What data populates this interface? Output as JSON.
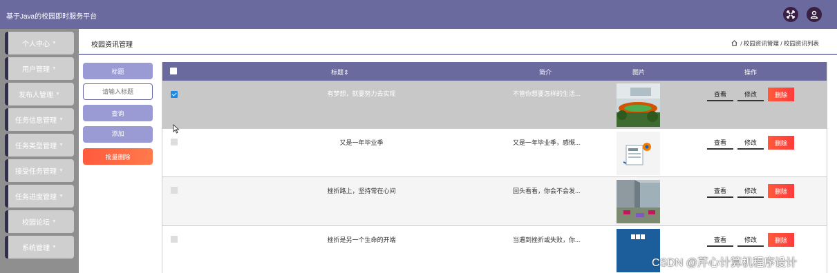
{
  "app": {
    "title": "基于Java的校园即时服务平台"
  },
  "sidebar": {
    "items": [
      {
        "label": "个人中心"
      },
      {
        "label": "用户管理"
      },
      {
        "label": "发布人管理"
      },
      {
        "label": "任务信息管理"
      },
      {
        "label": "任务类型管理"
      },
      {
        "label": "接受任务管理"
      },
      {
        "label": "任务进度管理"
      },
      {
        "label": "校园论坛"
      },
      {
        "label": "系统管理"
      }
    ]
  },
  "page": {
    "title": "校园资讯管理",
    "breadcrumb": "/ 校园资讯管理 / 校园资讯列表"
  },
  "search": {
    "field_label": "标题",
    "placeholder": "请输入标题",
    "query_label": "查询",
    "add_label": "添加",
    "batch_delete_label": "批量删除"
  },
  "table": {
    "headers": {
      "title": "标题",
      "intro": "简介",
      "image": "图片",
      "actions": "操作"
    },
    "action_labels": {
      "view": "查看",
      "edit": "修改",
      "delete": "删除"
    },
    "rows": [
      {
        "title": "有梦想，就要努力去实现",
        "intro": "不管你想要怎样的生活...",
        "selected": true
      },
      {
        "title": "又是一年毕业季",
        "intro": "又是一年毕业季，感慨...",
        "selected": false
      },
      {
        "title": "挫折路上，坚持常在心间",
        "intro": "回头看看，你会不会发...",
        "selected": false
      },
      {
        "title": "挫折是另一个生命的开端",
        "intro": "当遇到挫折或失败，你...",
        "selected": false
      }
    ]
  },
  "watermark": "CSDN @芹心计算机程序设计",
  "colors": {
    "header": "#6a6a9e",
    "accent": "#9a9ad4",
    "danger": "#ff5a3c",
    "selected_row": "#c8c8c8"
  }
}
